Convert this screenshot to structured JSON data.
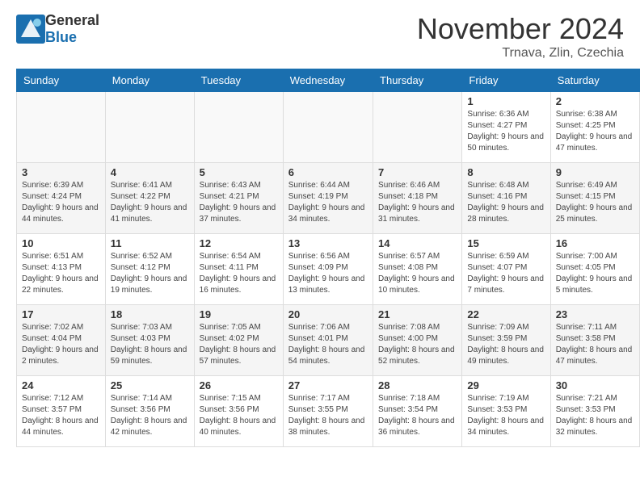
{
  "header": {
    "logo": {
      "general": "General",
      "blue": "Blue"
    },
    "title": "November 2024",
    "location": "Trnava, Zlin, Czechia"
  },
  "calendar": {
    "days_of_week": [
      "Sunday",
      "Monday",
      "Tuesday",
      "Wednesday",
      "Thursday",
      "Friday",
      "Saturday"
    ],
    "weeks": [
      [
        {
          "day": "",
          "info": ""
        },
        {
          "day": "",
          "info": ""
        },
        {
          "day": "",
          "info": ""
        },
        {
          "day": "",
          "info": ""
        },
        {
          "day": "",
          "info": ""
        },
        {
          "day": "1",
          "info": "Sunrise: 6:36 AM\nSunset: 4:27 PM\nDaylight: 9 hours and 50 minutes."
        },
        {
          "day": "2",
          "info": "Sunrise: 6:38 AM\nSunset: 4:25 PM\nDaylight: 9 hours and 47 minutes."
        }
      ],
      [
        {
          "day": "3",
          "info": "Sunrise: 6:39 AM\nSunset: 4:24 PM\nDaylight: 9 hours and 44 minutes."
        },
        {
          "day": "4",
          "info": "Sunrise: 6:41 AM\nSunset: 4:22 PM\nDaylight: 9 hours and 41 minutes."
        },
        {
          "day": "5",
          "info": "Sunrise: 6:43 AM\nSunset: 4:21 PM\nDaylight: 9 hours and 37 minutes."
        },
        {
          "day": "6",
          "info": "Sunrise: 6:44 AM\nSunset: 4:19 PM\nDaylight: 9 hours and 34 minutes."
        },
        {
          "day": "7",
          "info": "Sunrise: 6:46 AM\nSunset: 4:18 PM\nDaylight: 9 hours and 31 minutes."
        },
        {
          "day": "8",
          "info": "Sunrise: 6:48 AM\nSunset: 4:16 PM\nDaylight: 9 hours and 28 minutes."
        },
        {
          "day": "9",
          "info": "Sunrise: 6:49 AM\nSunset: 4:15 PM\nDaylight: 9 hours and 25 minutes."
        }
      ],
      [
        {
          "day": "10",
          "info": "Sunrise: 6:51 AM\nSunset: 4:13 PM\nDaylight: 9 hours and 22 minutes."
        },
        {
          "day": "11",
          "info": "Sunrise: 6:52 AM\nSunset: 4:12 PM\nDaylight: 9 hours and 19 minutes."
        },
        {
          "day": "12",
          "info": "Sunrise: 6:54 AM\nSunset: 4:11 PM\nDaylight: 9 hours and 16 minutes."
        },
        {
          "day": "13",
          "info": "Sunrise: 6:56 AM\nSunset: 4:09 PM\nDaylight: 9 hours and 13 minutes."
        },
        {
          "day": "14",
          "info": "Sunrise: 6:57 AM\nSunset: 4:08 PM\nDaylight: 9 hours and 10 minutes."
        },
        {
          "day": "15",
          "info": "Sunrise: 6:59 AM\nSunset: 4:07 PM\nDaylight: 9 hours and 7 minutes."
        },
        {
          "day": "16",
          "info": "Sunrise: 7:00 AM\nSunset: 4:05 PM\nDaylight: 9 hours and 5 minutes."
        }
      ],
      [
        {
          "day": "17",
          "info": "Sunrise: 7:02 AM\nSunset: 4:04 PM\nDaylight: 9 hours and 2 minutes."
        },
        {
          "day": "18",
          "info": "Sunrise: 7:03 AM\nSunset: 4:03 PM\nDaylight: 8 hours and 59 minutes."
        },
        {
          "day": "19",
          "info": "Sunrise: 7:05 AM\nSunset: 4:02 PM\nDaylight: 8 hours and 57 minutes."
        },
        {
          "day": "20",
          "info": "Sunrise: 7:06 AM\nSunset: 4:01 PM\nDaylight: 8 hours and 54 minutes."
        },
        {
          "day": "21",
          "info": "Sunrise: 7:08 AM\nSunset: 4:00 PM\nDaylight: 8 hours and 52 minutes."
        },
        {
          "day": "22",
          "info": "Sunrise: 7:09 AM\nSunset: 3:59 PM\nDaylight: 8 hours and 49 minutes."
        },
        {
          "day": "23",
          "info": "Sunrise: 7:11 AM\nSunset: 3:58 PM\nDaylight: 8 hours and 47 minutes."
        }
      ],
      [
        {
          "day": "24",
          "info": "Sunrise: 7:12 AM\nSunset: 3:57 PM\nDaylight: 8 hours and 44 minutes."
        },
        {
          "day": "25",
          "info": "Sunrise: 7:14 AM\nSunset: 3:56 PM\nDaylight: 8 hours and 42 minutes."
        },
        {
          "day": "26",
          "info": "Sunrise: 7:15 AM\nSunset: 3:56 PM\nDaylight: 8 hours and 40 minutes."
        },
        {
          "day": "27",
          "info": "Sunrise: 7:17 AM\nSunset: 3:55 PM\nDaylight: 8 hours and 38 minutes."
        },
        {
          "day": "28",
          "info": "Sunrise: 7:18 AM\nSunset: 3:54 PM\nDaylight: 8 hours and 36 minutes."
        },
        {
          "day": "29",
          "info": "Sunrise: 7:19 AM\nSunset: 3:53 PM\nDaylight: 8 hours and 34 minutes."
        },
        {
          "day": "30",
          "info": "Sunrise: 7:21 AM\nSunset: 3:53 PM\nDaylight: 8 hours and 32 minutes."
        }
      ]
    ]
  }
}
